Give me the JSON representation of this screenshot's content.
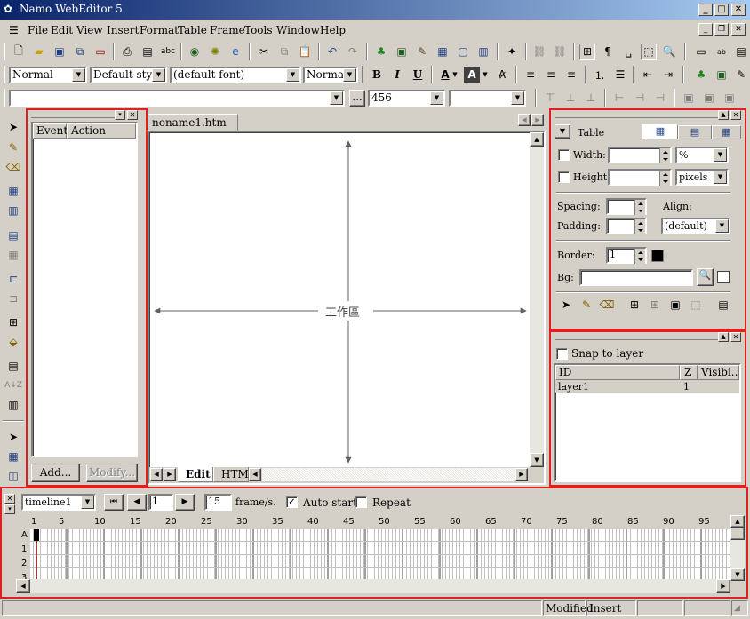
{
  "window": {
    "title": "Namo WebEditor 5"
  },
  "menu": [
    {
      "label": "File"
    },
    {
      "label": "Edit"
    },
    {
      "label": "View"
    },
    {
      "label": "Insert"
    },
    {
      "label": "Format"
    },
    {
      "label": "Table"
    },
    {
      "label": "Frame"
    },
    {
      "label": "Tools"
    },
    {
      "label": "Window"
    },
    {
      "label": "Help"
    }
  ],
  "format_bar": {
    "paragraph_style": "Normal",
    "text_style": "Default style",
    "font": "(default font)",
    "size": "Normal",
    "bold": "B",
    "italic": "I",
    "underline": "U"
  },
  "url_bar": {
    "value": "",
    "more": "...",
    "number_value": "456"
  },
  "event_panel": {
    "col_event": "Event",
    "col_action": "Action",
    "add_button": "Add...",
    "modify_button": "Modify..."
  },
  "document": {
    "tab": "noname1.htm",
    "work_area_label": "工作區",
    "view_tabs": [
      {
        "label": "Edit"
      },
      {
        "label": "HTM"
      }
    ]
  },
  "table_panel": {
    "dropdown_label": "Table",
    "width_label": "Width:",
    "width_unit": "%",
    "height_label": "Height:",
    "height_unit": "pixels",
    "spacing_label": "Spacing:",
    "align_label": "Align:",
    "padding_label": "Padding:",
    "align_value": "(default)",
    "border_label": "Border:",
    "border_value": "1",
    "bg_label": "Bg:"
  },
  "layer_panel": {
    "snap_label": "Snap to layer",
    "columns": [
      "ID",
      "Z",
      "Visibi..."
    ],
    "rows": [
      {
        "id": "layer1",
        "z": "1",
        "visibility": ""
      }
    ]
  },
  "timeline": {
    "name": "timeline1",
    "frame": "1",
    "fps": "15",
    "fps_label": "frame/s.",
    "auto_start_label": "Auto start",
    "auto_start": true,
    "repeat_label": "Repeat",
    "repeat": false,
    "ticks": [
      "1",
      "5",
      "10",
      "15",
      "20",
      "25",
      "30",
      "35",
      "40",
      "45",
      "50",
      "55",
      "60",
      "65",
      "70",
      "75",
      "80",
      "85",
      "90",
      "95"
    ],
    "rows": [
      "A",
      "1",
      "2",
      "3"
    ]
  },
  "status": {
    "modified": "Modified",
    "insert": "Insert"
  },
  "colors": {
    "highlight": "#e02020",
    "titlebar": "#0a246a",
    "face": "#d4d0c8"
  }
}
